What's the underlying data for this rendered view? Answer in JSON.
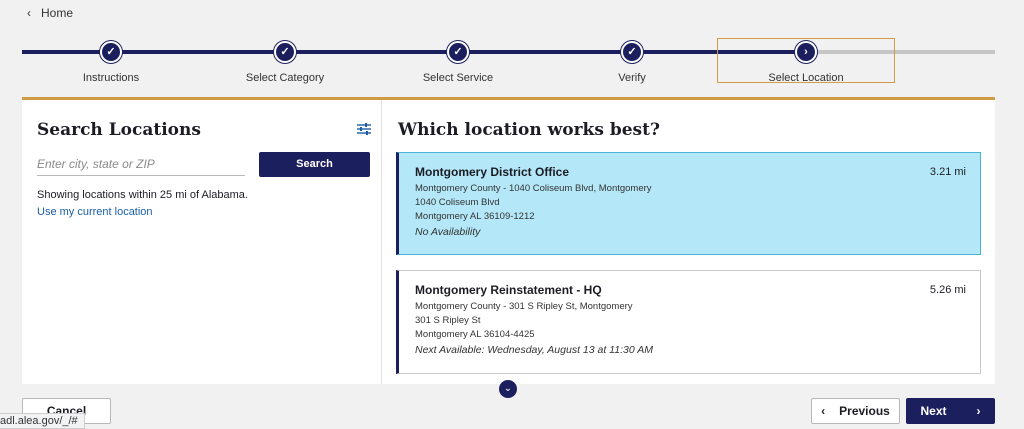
{
  "nav": {
    "home_label": "Home"
  },
  "stepper": {
    "steps": [
      {
        "label": "Instructions",
        "state": "done"
      },
      {
        "label": "Select Category",
        "state": "done"
      },
      {
        "label": "Select Service",
        "state": "done"
      },
      {
        "label": "Verify",
        "state": "done"
      },
      {
        "label": "Select Location",
        "state": "active"
      }
    ],
    "done_glyph": "✓",
    "active_glyph": "›"
  },
  "search": {
    "title": "Search Locations",
    "placeholder": "Enter city, state or ZIP",
    "value": "",
    "button_label": "Search",
    "showing_text": "Showing locations within 25 mi of Alabama.",
    "use_location_label": "Use my current location",
    "filter_icon": "sliders-icon"
  },
  "results": {
    "title": "Which location works best?",
    "locations": [
      {
        "name": "Montgomery District Office",
        "distance": "3.21 mi",
        "county_line": "Montgomery County - 1040 Coliseum Blvd, Montgomery",
        "street": "1040 Coliseum Blvd",
        "city_line": "Montgomery AL 36109-1212",
        "availability": "No Availability",
        "selected": true
      },
      {
        "name": "Montgomery Reinstatement - HQ",
        "distance": "5.26 mi",
        "county_line": "Montgomery County - 301 S Ripley St, Montgomery",
        "street": "301 S Ripley St",
        "city_line": "Montgomery AL 36104-4425",
        "availability": "Next Available: Wednesday, August 13 at 11:30 AM",
        "selected": false
      }
    ]
  },
  "footer": {
    "cancel_label": "Cancel",
    "previous_label": "Previous",
    "next_label": "Next"
  },
  "status_bar": {
    "url": "adl.alea.gov/_/#"
  },
  "colors": {
    "navy": "#1c1f5e",
    "gold": "#d09b45",
    "selected_bg": "#b4e8f8"
  }
}
